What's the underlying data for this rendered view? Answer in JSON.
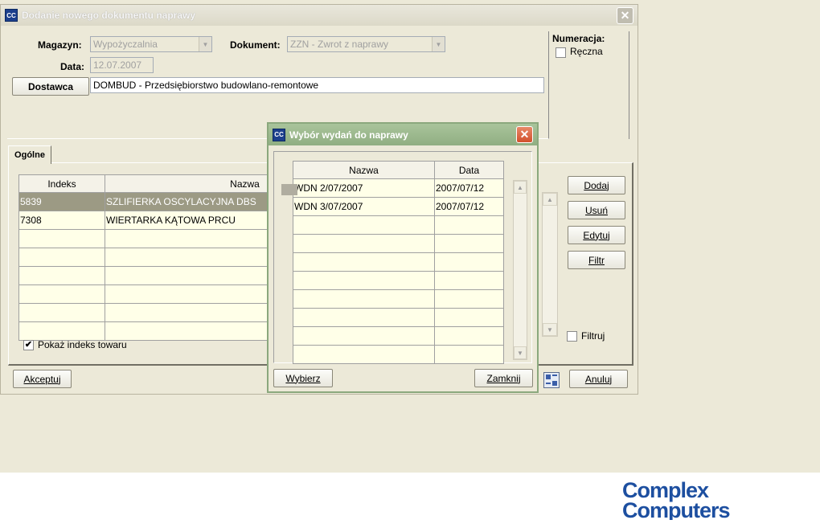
{
  "main_window": {
    "title": "Dodanie nowego dokumentu naprawy",
    "icon_label": "CC",
    "close_glyph": "✕"
  },
  "header": {
    "magazyn_label": "Magazyn:",
    "magazyn_value": "Wypożyczalnia",
    "dokument_label": "Dokument:",
    "dokument_value": "ZZN - Zwrot z naprawy",
    "data_label": "Data:",
    "data_value": "12.07.2007",
    "dostawca_button": "Dostawca",
    "dostawca_value": "DOMBUD - Przedsiębiorstwo budowlano-remontowe"
  },
  "numeracja": {
    "label": "Numeracja:",
    "reczna_label": "Ręczna",
    "reczna_checked": false
  },
  "tab": {
    "label": "Ogólne"
  },
  "grid": {
    "columns": [
      "Indeks",
      "Nazwa"
    ],
    "rows": [
      [
        "5839",
        "SZLIFIERKA OSCYLACYJNA DBS"
      ],
      [
        "7308",
        "WIERTARKA KĄTOWA PRCU"
      ],
      [
        "",
        ""
      ],
      [
        "",
        ""
      ],
      [
        "",
        ""
      ],
      [
        "",
        ""
      ],
      [
        "",
        ""
      ],
      [
        "",
        ""
      ]
    ],
    "selected_row": 0
  },
  "pokaz_indeks": {
    "label": "Pokaż indeks towaru",
    "checked": true,
    "mark": "✔"
  },
  "side_buttons": {
    "dodaj": "Dodaj",
    "usun": "Usuń",
    "edytuj": "Edytuj",
    "filtr": "Filtr"
  },
  "filtruj": {
    "label": "Filtruj",
    "checked": false
  },
  "bottom_buttons": {
    "akceptuj": "Akceptuj",
    "anuluj": "Anuluj"
  },
  "dialog": {
    "title": "Wybór wydań do naprawy",
    "icon_label": "CC",
    "close_glyph": "✕",
    "columns": [
      "Nazwa",
      "Data"
    ],
    "rows": [
      [
        "WDN 2/07/2007",
        "2007/07/12"
      ],
      [
        "WDN 3/07/2007",
        "2007/07/12"
      ],
      [
        "",
        ""
      ],
      [
        "",
        ""
      ],
      [
        "",
        ""
      ],
      [
        "",
        ""
      ],
      [
        "",
        ""
      ],
      [
        "",
        ""
      ],
      [
        "",
        ""
      ],
      [
        "",
        ""
      ]
    ],
    "wybierz": "Wybierz",
    "zamknij": "Zamknij"
  },
  "scroll": {
    "up": "▲",
    "down": "▼"
  },
  "combo_arrow": "▼",
  "brand": {
    "line1": "Complex",
    "line2": "Computers",
    "color": "#1d4fa0"
  }
}
